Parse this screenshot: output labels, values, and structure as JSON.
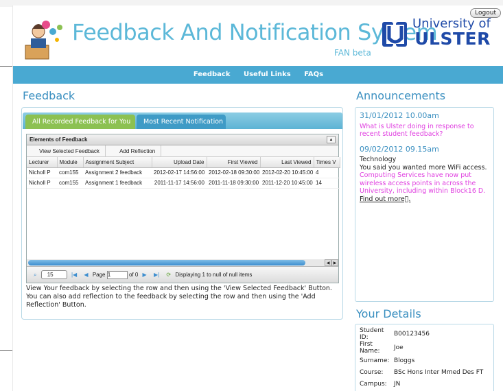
{
  "header": {
    "title": "Feedback And Notification System",
    "subtitle": "FAN beta",
    "university_line1": "University of",
    "university_line2": "ULSTER",
    "logout_label": "Logout"
  },
  "nav": {
    "items": [
      "Feedback",
      "Useful Links",
      "FAQs"
    ]
  },
  "feedback": {
    "heading": "Feedback",
    "tabs": [
      "All Recorded Feedback for You",
      "Most Recent Notification"
    ],
    "grid_title": "Elements of Feedback",
    "toolbar": [
      "View Selected Feedback",
      "Add Reflection"
    ],
    "columns": [
      "Lecturer",
      "Module",
      "Assignment Subject",
      "Upload Date",
      "First Viewed",
      "Last Viewed",
      "Times V"
    ],
    "rows": [
      [
        "Nicholl P",
        "com155",
        "Assignment 2 feedback",
        "2012-02-17 14:56:00",
        "2012-02-18 09:30:00",
        "2012-02-20 10:45:00",
        "4"
      ],
      [
        "Nicholl P",
        "com155",
        "Assignment 1 feedback",
        "2011-11-17 14:56:00",
        "2011-11-18 09:30:00",
        "2011-12-20 10:45:00",
        "14"
      ]
    ],
    "pager": {
      "page_size": "15",
      "page_label": "Page",
      "page_value": "1",
      "of_label": "of 0",
      "display_text": "Displaying 1 to null of null items"
    },
    "help_text": "View Your feedback by selecting the row and then using the 'View Selected Feedback' Button. You can also add reflection to the feedback by selecting the row and then using the 'Add Reflection' Button."
  },
  "announcements": {
    "heading": "Announcements",
    "items": [
      {
        "date": "31/01/2012 10.00am",
        "link": "What is Ulster doing in response to recent student feedback?"
      },
      {
        "date": "09/02/2012 09.15am",
        "category": "Technology",
        "body": "You said you wanted more WiFi access.",
        "link": "Computing Services have now put wireless access points in across the University, including within Block16 D.",
        "more": "Find out more\u0000."
      }
    ]
  },
  "details": {
    "heading": "Your Details",
    "fields": [
      {
        "label": "Student ID:",
        "value": "B00123456"
      },
      {
        "label": "First Name:",
        "value": "Joe"
      },
      {
        "label": "Surname:",
        "value": "Bloggs"
      },
      {
        "label": "Course:",
        "value": "BSc Hons Inter Mmed Des FT"
      },
      {
        "label": "Campus:",
        "value": "JN"
      }
    ]
  },
  "colors": {
    "accent": "#49a9d2",
    "tab_active": "#8cc152",
    "link_pink": "#e040e0",
    "university_blue": "#1f4aa8"
  }
}
